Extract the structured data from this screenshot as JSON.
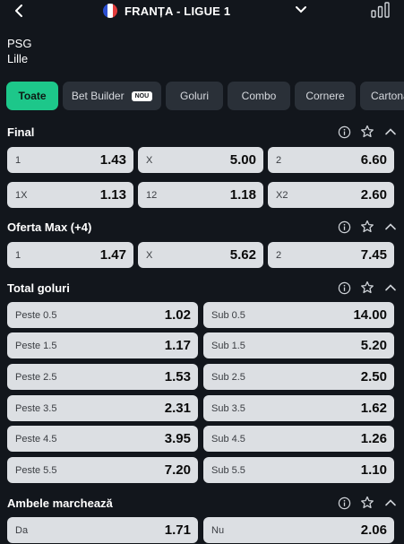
{
  "header": {
    "league": "FRANȚA - LIGUE 1"
  },
  "teams": {
    "home": "PSG",
    "away": "Lille"
  },
  "tabs": [
    {
      "label": "Toate"
    },
    {
      "label": "Bet Builder",
      "badge": "NOU"
    },
    {
      "label": "Goluri"
    },
    {
      "label": "Combo"
    },
    {
      "label": "Cornere"
    },
    {
      "label": "Cartonaș"
    }
  ],
  "sections": {
    "final": {
      "title": "Final",
      "row1": [
        {
          "label": "1",
          "odd": "1.43"
        },
        {
          "label": "X",
          "odd": "5.00"
        },
        {
          "label": "2",
          "odd": "6.60"
        }
      ],
      "row2": [
        {
          "label": "1X",
          "odd": "1.13"
        },
        {
          "label": "12",
          "odd": "1.18"
        },
        {
          "label": "X2",
          "odd": "2.60"
        }
      ]
    },
    "oferta": {
      "title": "Oferta Max (+4)",
      "row1": [
        {
          "label": "1",
          "odd": "1.47"
        },
        {
          "label": "X",
          "odd": "5.62"
        },
        {
          "label": "2",
          "odd": "7.45"
        }
      ]
    },
    "total": {
      "title": "Total goluri",
      "rows": [
        {
          "over": {
            "label": "Peste 0.5",
            "odd": "1.02"
          },
          "under": {
            "label": "Sub 0.5",
            "odd": "14.00"
          }
        },
        {
          "over": {
            "label": "Peste 1.5",
            "odd": "1.17"
          },
          "under": {
            "label": "Sub 1.5",
            "odd": "5.20"
          }
        },
        {
          "over": {
            "label": "Peste 2.5",
            "odd": "1.53"
          },
          "under": {
            "label": "Sub 2.5",
            "odd": "2.50"
          }
        },
        {
          "over": {
            "label": "Peste 3.5",
            "odd": "2.31"
          },
          "under": {
            "label": "Sub 3.5",
            "odd": "1.62"
          }
        },
        {
          "over": {
            "label": "Peste 4.5",
            "odd": "3.95"
          },
          "under": {
            "label": "Sub 4.5",
            "odd": "1.26"
          }
        },
        {
          "over": {
            "label": "Peste 5.5",
            "odd": "7.20"
          },
          "under": {
            "label": "Sub 5.5",
            "odd": "1.10"
          }
        }
      ]
    },
    "ambele": {
      "title": "Ambele marchează",
      "row1": [
        {
          "label": "Da",
          "odd": "1.71"
        },
        {
          "label": "Nu",
          "odd": "2.06"
        }
      ]
    }
  },
  "icons": {
    "back": "back-arrow-icon",
    "flag": "france-flag-icon",
    "dropdown": "chevron-down-icon",
    "stats": "bar-chart-icon",
    "info": "info-icon",
    "favorite": "star-icon",
    "collapse": "chevron-up-icon"
  },
  "colors": {
    "accent": "#1dc78a",
    "background": "#12161c",
    "tab": "#2a3038",
    "odd_button": "#dcdfe3"
  }
}
